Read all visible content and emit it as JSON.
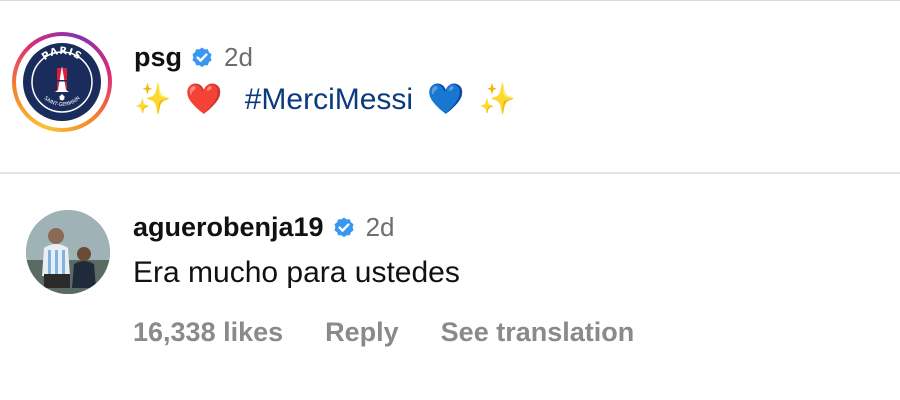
{
  "post": {
    "username": "psg",
    "time": "2d",
    "caption": {
      "emoji_left_sparkles": "✨",
      "emoji_red_heart": "❤️",
      "hashtag": "#MerciMessi",
      "emoji_blue_heart": "💙",
      "emoji_right_sparkles": "✨"
    },
    "avatar_icon": "psg-logo-icon",
    "verified_icon": "verified-badge-icon",
    "logo_text_top": "PARIS",
    "logo_text_bottom": "SAINT-GERMAIN"
  },
  "comment": {
    "username": "aguerobenja19",
    "time": "2d",
    "text": "Era mucho para ustedes",
    "likes_label": "16,338 likes",
    "reply_label": "Reply",
    "translation_label": "See translation",
    "verified_icon": "verified-badge-icon"
  },
  "colors": {
    "verified_blue": "#3897f0",
    "hashtag": "#0b3a7e",
    "secondary_text": "#8a8a8a",
    "psg_navy": "#1a2c5b",
    "psg_red": "#d6203c"
  }
}
